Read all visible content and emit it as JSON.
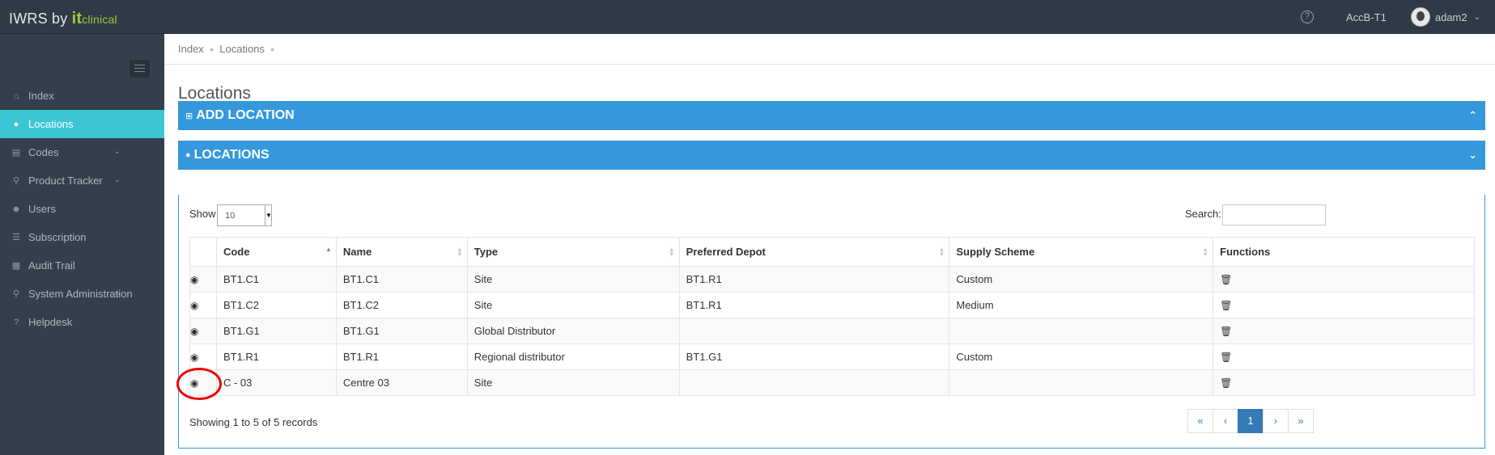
{
  "app": {
    "brand_prefix": "IWRS by ",
    "brand_it": "it",
    "brand_clinical": "clinical"
  },
  "topbar": {
    "help_icon": "question-circle-icon",
    "project": "AccB-T1",
    "user": "adam2"
  },
  "sidebar": {
    "items": [
      {
        "label": "Index",
        "icon": "home-icon"
      },
      {
        "label": "Locations",
        "icon": "globe-icon",
        "active": true
      },
      {
        "label": "Codes",
        "icon": "barcode-icon",
        "has_submenu": true
      },
      {
        "label": "Product Tracker",
        "icon": "map-marker-icon",
        "has_submenu": true
      },
      {
        "label": "Users",
        "icon": "users-icon"
      },
      {
        "label": "Subscription",
        "icon": "list-icon"
      },
      {
        "label": "Audit Trail",
        "icon": "book-icon"
      },
      {
        "label": "System Administration",
        "icon": "map-marker-icon",
        "has_submenu": true
      },
      {
        "label": "Helpdesk",
        "icon": "question-icon"
      }
    ]
  },
  "breadcrumb": [
    "Index",
    "Locations"
  ],
  "page_title": "Locations",
  "add_panel": {
    "title": "ADD LOCATION"
  },
  "list_panel": {
    "title": "LOCATIONS"
  },
  "table_controls": {
    "show_label": "Show",
    "page_size": "10",
    "search_label": "Search:",
    "search_value": ""
  },
  "table": {
    "columns": [
      "",
      "Code",
      "Name",
      "Type",
      "Preferred Depot",
      "Supply Scheme",
      "Functions"
    ],
    "rows": [
      {
        "code": "BT1.C1",
        "name": "BT1.C1",
        "type": "Site",
        "depot": "BT1.R1",
        "scheme": "Custom"
      },
      {
        "code": "BT1.C2",
        "name": "BT1.C2",
        "type": "Site",
        "depot": "BT1.R1",
        "scheme": "Medium"
      },
      {
        "code": "BT1.G1",
        "name": "BT1.G1",
        "type": "Global Distributor",
        "depot": "",
        "scheme": ""
      },
      {
        "code": "BT1.R1",
        "name": "BT1.R1",
        "type": "Regional distributor",
        "depot": "BT1.G1",
        "scheme": "Custom"
      },
      {
        "code": "C - 03",
        "name": "Centre 03",
        "type": "Site",
        "depot": "",
        "scheme": ""
      }
    ]
  },
  "footer": {
    "info": "Showing 1 to 5 of 5 records",
    "pager": [
      "«",
      "‹",
      "1",
      "›",
      "»"
    ],
    "current_page": "1"
  },
  "colors": {
    "topbar": "#2f3a46",
    "sidebar": "#333f4b",
    "sidebar_active": "#3bc6d3",
    "panel_header": "#3598dc",
    "link": "#337ab7",
    "highlight_circle": "#ec0000"
  }
}
